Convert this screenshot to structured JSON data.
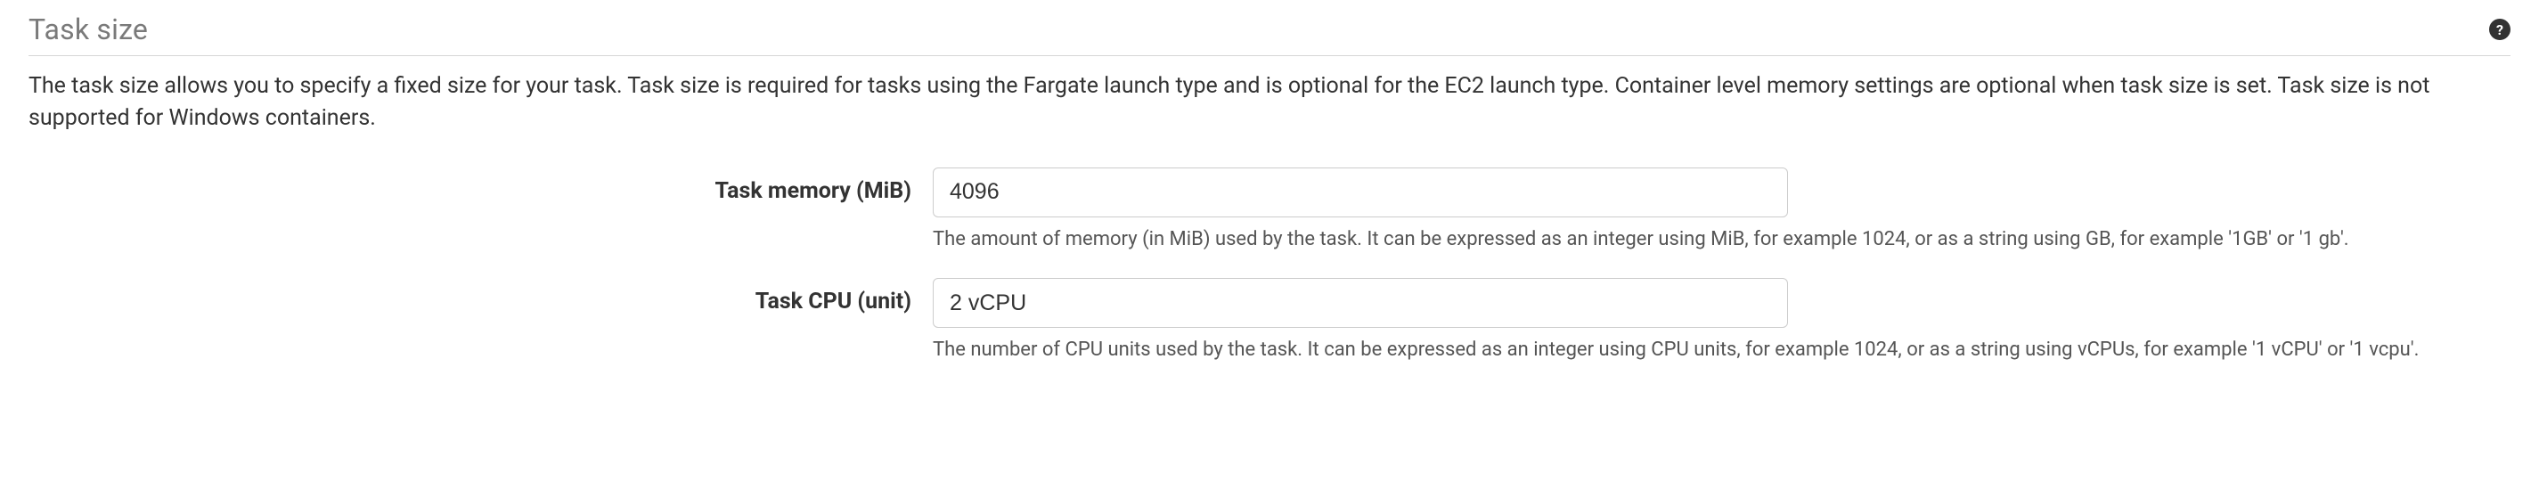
{
  "section": {
    "title": "Task size",
    "description": "The task size allows you to specify a fixed size for your task. Task size is required for tasks using the Fargate launch type and is optional for the EC2 launch type. Container level memory settings are optional when task size is set. Task size is not supported for Windows containers."
  },
  "fields": {
    "memory": {
      "label": "Task memory (MiB)",
      "value": "4096",
      "help": "The amount of memory (in MiB) used by the task. It can be expressed as an integer using MiB, for example 1024, or as a string using GB, for example '1GB' or '1 gb'."
    },
    "cpu": {
      "label": "Task CPU (unit)",
      "value": "2 vCPU",
      "help": "The number of CPU units used by the task. It can be expressed as an integer using CPU units, for example 1024, or as a string using vCPUs, for example '1 vCPU' or '1 vcpu'."
    }
  },
  "helpIcon": "?"
}
